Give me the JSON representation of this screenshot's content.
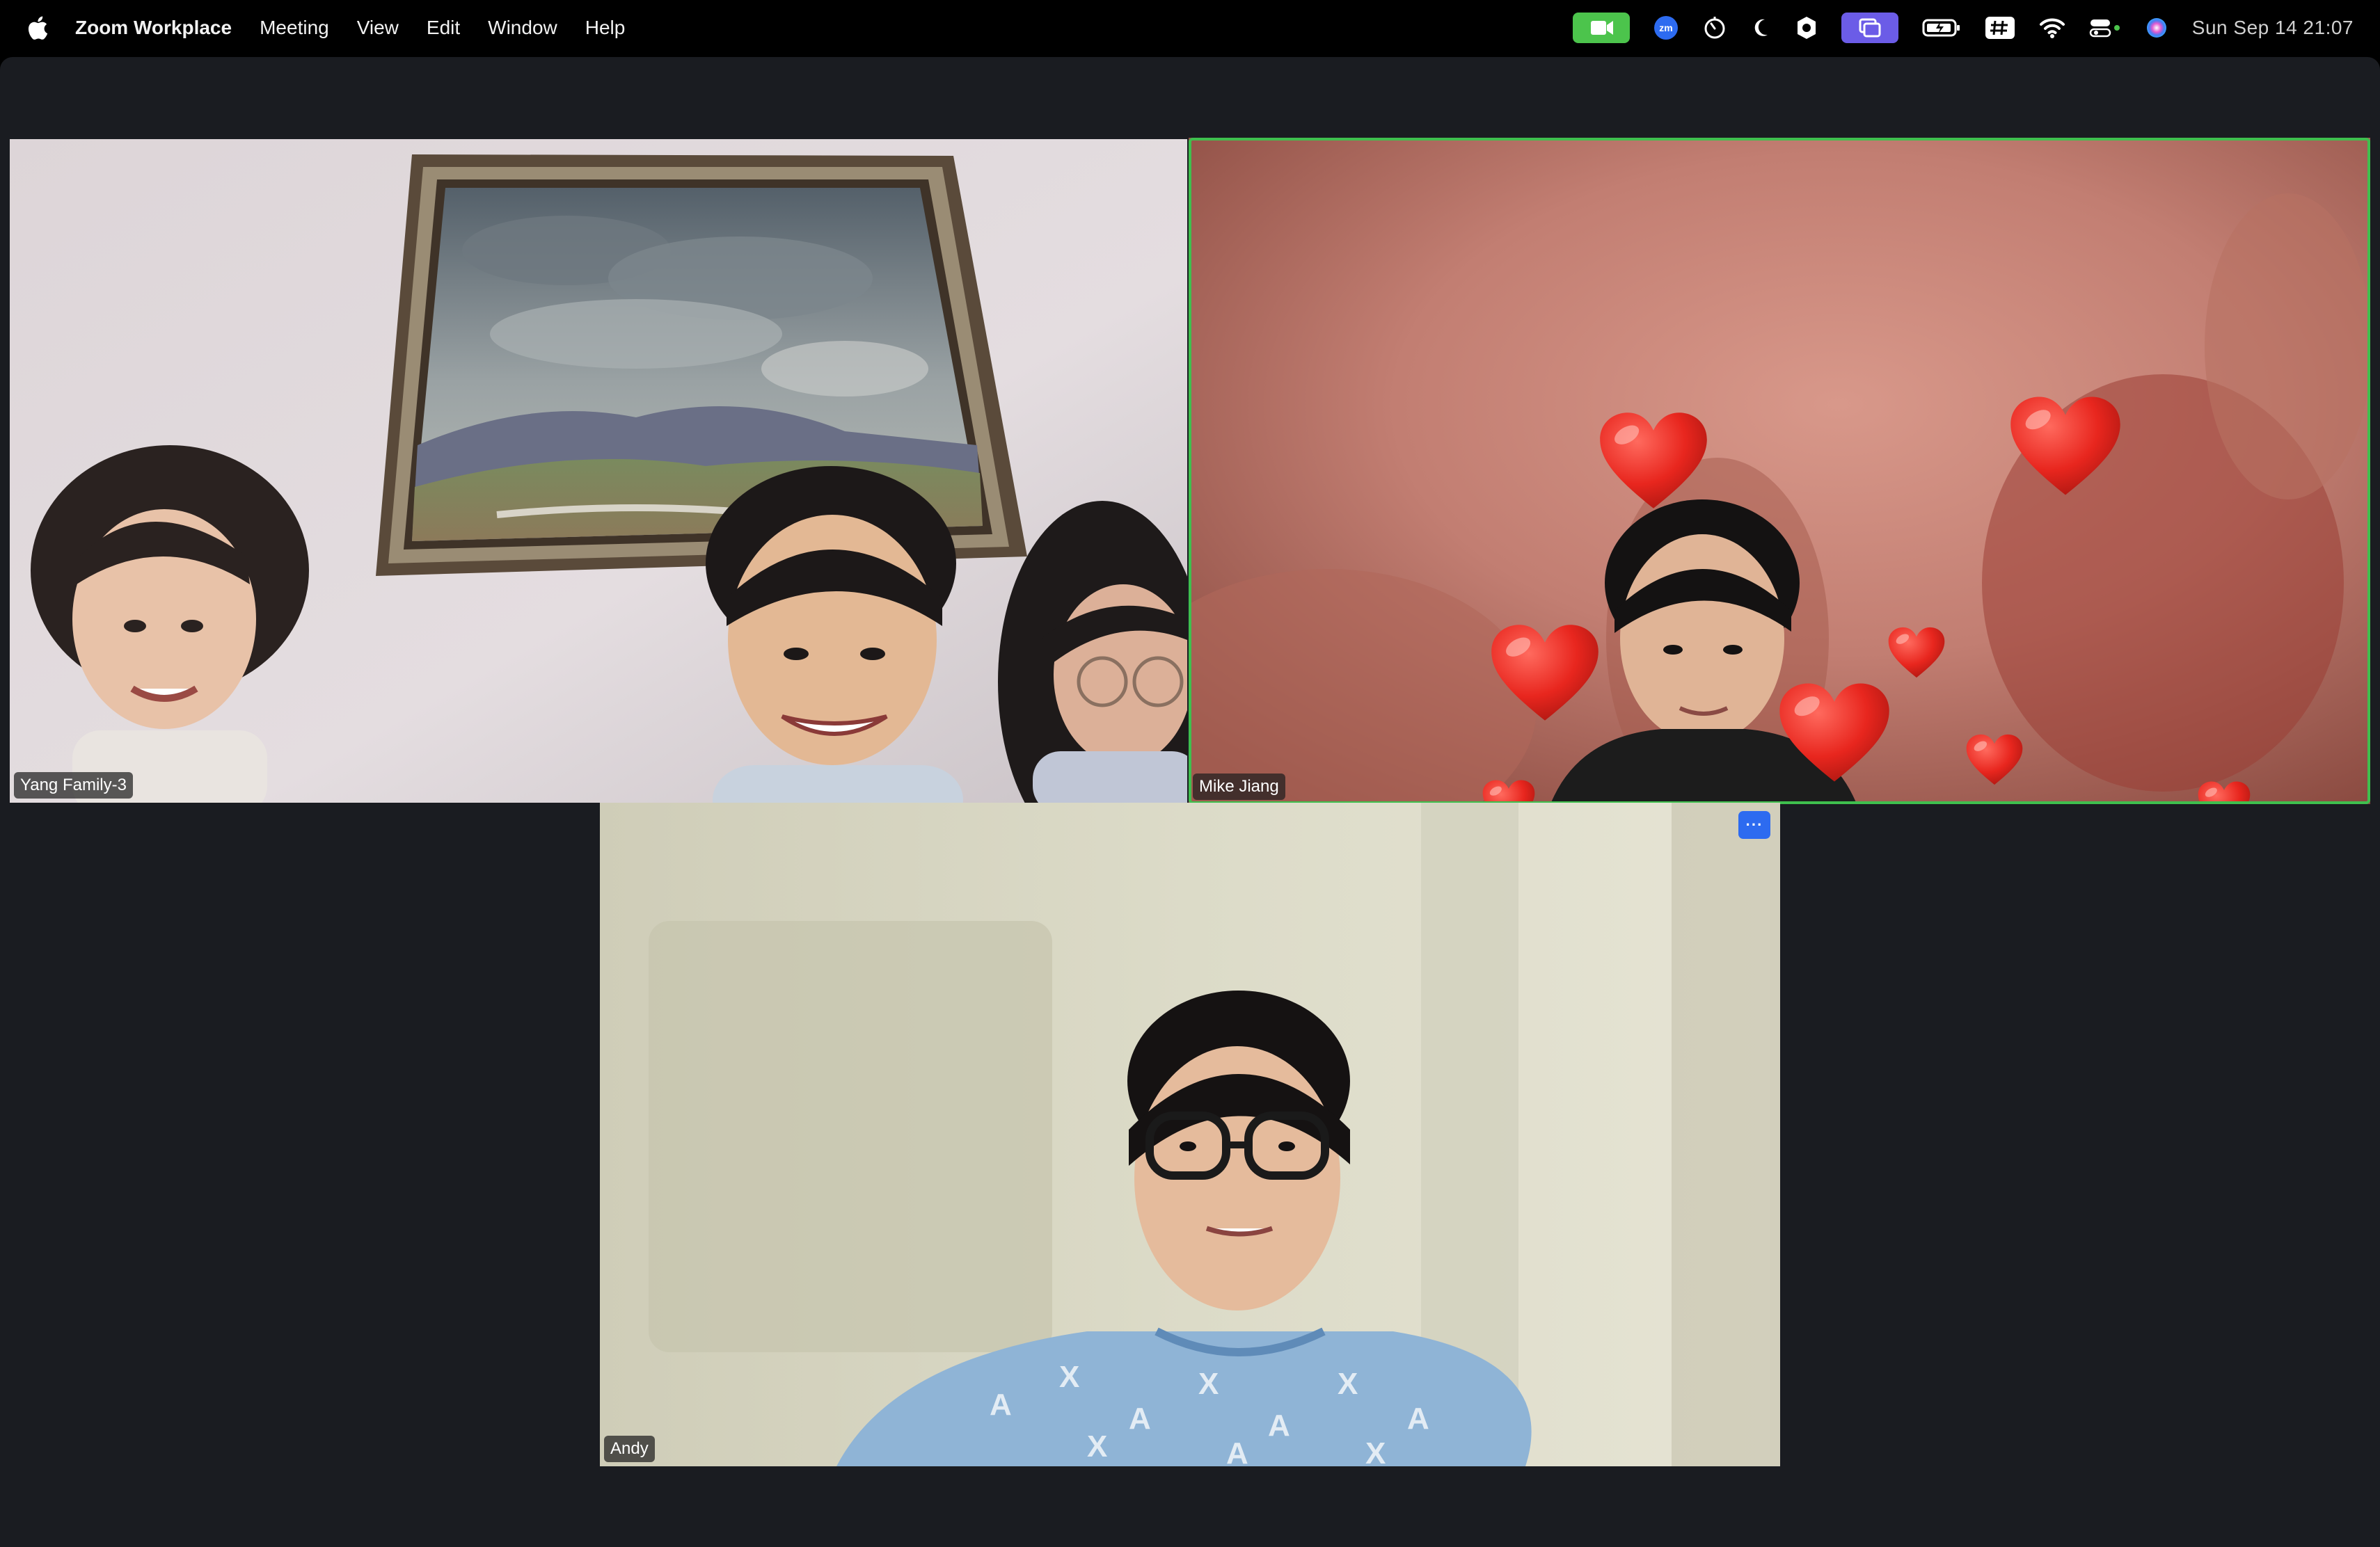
{
  "menubar": {
    "app_name": "Zoom Workplace",
    "menus": [
      "Meeting",
      "View",
      "Edit",
      "Window",
      "Help"
    ],
    "status_icons": [
      "zoom-video-icon",
      "zoom-app-icon",
      "timer-icon",
      "moon-icon",
      "shield-icon",
      "screen-share-icon",
      "battery-icon",
      "grid-icon",
      "wifi-icon",
      "control-center-icon",
      "siri-icon"
    ],
    "datetime": "Sun Sep 14  21:07"
  },
  "meeting": {
    "participants": [
      {
        "name": "Yang Family-3",
        "active_speaker": false
      },
      {
        "name": "Mike Jiang",
        "active_speaker": true
      },
      {
        "name": "Andy",
        "active_speaker": false
      }
    ],
    "more_options_label": "···"
  },
  "colors": {
    "window_bg": "#1a1c21",
    "active_speaker_border": "#3fbf4e",
    "more_button": "#2d6bf0",
    "camera_indicator": "#4cc44c",
    "screen_share_indicator": "#6b5ce7"
  }
}
